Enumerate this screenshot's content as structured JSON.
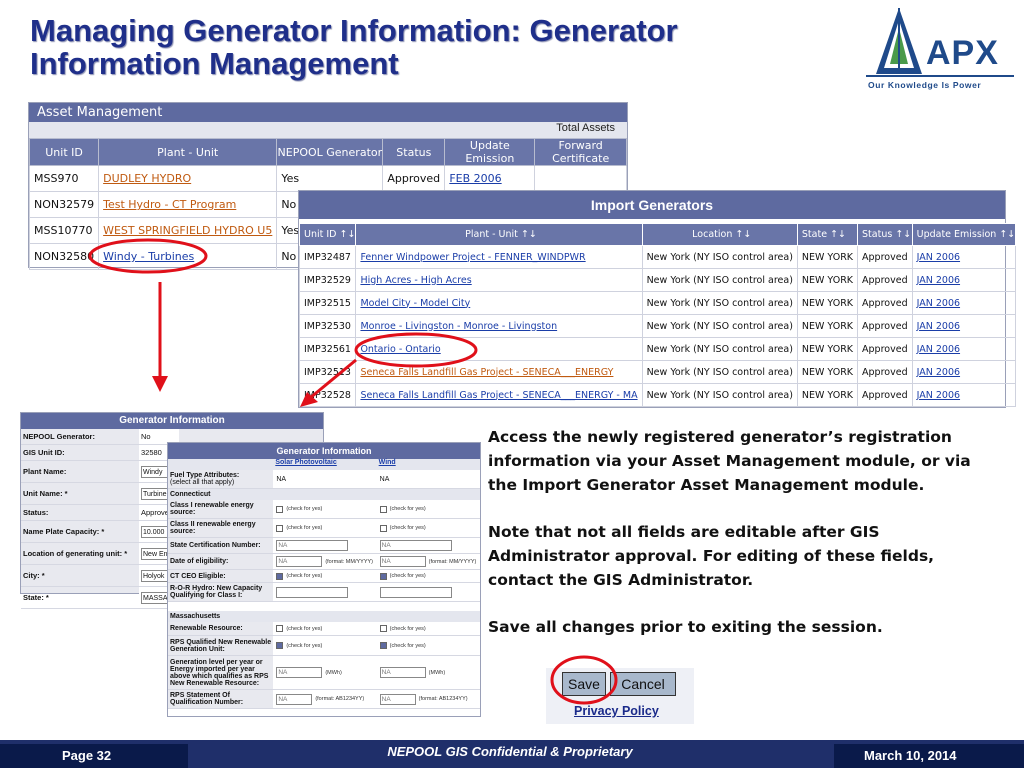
{
  "slide": {
    "title_line1": "Managing Generator Information: Generator",
    "title_line2": "Information Management",
    "logo_text": "APX",
    "logo_tagline": "Our Knowledge Is Power"
  },
  "asset_management": {
    "title": "Asset Management",
    "total_label": "Total Assets",
    "columns": [
      "Unit ID",
      "Plant - Unit",
      "NEPOOL Generator",
      "Status",
      "Update Emission",
      "Forward Certificate"
    ],
    "rows": [
      {
        "unit_id": "MSS970",
        "plant": "DUDLEY HYDRO",
        "nepool": "Yes",
        "status": "Approved",
        "update": "FEB 2006",
        "forward": ""
      },
      {
        "unit_id": "NON32579",
        "plant": "Test Hydro - CT Program",
        "nepool": "No",
        "status": "",
        "update": "",
        "forward": ""
      },
      {
        "unit_id": "MSS10770",
        "plant": "WEST SPRINGFIELD HYDRO U5",
        "nepool": "Yes",
        "status": "",
        "update": "",
        "forward": ""
      },
      {
        "unit_id": "NON32580",
        "plant": "Windy - Turbines",
        "nepool": "No",
        "status": "",
        "update": "",
        "forward": ""
      }
    ]
  },
  "import_generators": {
    "title": "Import Generators",
    "columns": [
      "Unit ID",
      "Plant - Unit",
      "Location",
      "State",
      "Status",
      "Update Emission"
    ],
    "rows": [
      {
        "unit_id": "IMP32487",
        "plant": "Fenner Windpower Project - FENNER_WINDPWR",
        "location": "New York (NY ISO control area)",
        "state": "NEW YORK",
        "status": "Approved",
        "update": "JAN 2006"
      },
      {
        "unit_id": "IMP32529",
        "plant": "High Acres - High Acres",
        "location": "New York (NY ISO control area)",
        "state": "NEW YORK",
        "status": "Approved",
        "update": "JAN 2006"
      },
      {
        "unit_id": "IMP32515",
        "plant": "Model City - Model City",
        "location": "New York (NY ISO control area)",
        "state": "NEW YORK",
        "status": "Approved",
        "update": "JAN 2006"
      },
      {
        "unit_id": "IMP32530",
        "plant": "Monroe - Livingston - Monroe - Livingston",
        "location": "New York (NY ISO control area)",
        "state": "NEW YORK",
        "status": "Approved",
        "update": "JAN 2006"
      },
      {
        "unit_id": "IMP32561",
        "plant": "Ontario - Ontario",
        "location": "New York (NY ISO control area)",
        "state": "NEW YORK",
        "status": "Approved",
        "update": "JAN 2006"
      },
      {
        "unit_id": "IMP32513",
        "plant": "Seneca Falls Landfill Gas Project - SENECA___ENERGY",
        "location": "New York (NY ISO control area)",
        "state": "NEW YORK",
        "status": "Approved",
        "update": "JAN 2006"
      },
      {
        "unit_id": "IMP32528",
        "plant": "Seneca Falls Landfill Gas Project - SENECA___ENERGY - MA",
        "location": "New York (NY ISO control area)",
        "state": "NEW YORK",
        "status": "Approved",
        "update": "JAN 2006"
      }
    ]
  },
  "gen_info_1": {
    "title": "Generator Information",
    "fields": [
      {
        "label": "NEPOOL Generator:",
        "value": "No"
      },
      {
        "label": "GIS Unit ID:",
        "value": "32580"
      },
      {
        "label": "Plant Name:",
        "value": "Windy"
      },
      {
        "label": "Unit Name: *",
        "value": "Turbine"
      },
      {
        "label": "Status:",
        "value": "Approve"
      },
      {
        "label": "Name Plate Capacity: *",
        "value": "10.000"
      },
      {
        "label": "Location of generating unit: *",
        "value": "New En"
      },
      {
        "label": "City: *",
        "value": "Holyok"
      },
      {
        "label": "State: *",
        "value": "MASSA"
      }
    ]
  },
  "gen_info_2": {
    "title": "Generator Information",
    "col1": "Solar Photovoltaic",
    "col2": "Wind",
    "fuel_label": "Fuel Type Attributes:",
    "fuel_sub": "(select all that apply)",
    "fuel_v1": "NA",
    "fuel_v2": "NA",
    "sec_ct": "Connecticut",
    "class1_label": "Class I renewable energy source:",
    "class2_label": "Class II renewable energy source:",
    "check_note": "(check for yes)",
    "cert_label": "State Certification Number:",
    "cert_v1": "NA",
    "cert_v2": "NA",
    "elig_label": "Date of eligibility:",
    "elig_v1": "NA",
    "elig_v2": "NA",
    "date_note": "(format: MM/YYYY)",
    "ceo_label": "CT CEO Eligible:",
    "ror_label": "R-O-R Hydro: New Capacity Qualifying for Class I:",
    "sec_ma": "Massachusetts",
    "rr_label": "Renewable Resource:",
    "rps_label": "RPS Qualified New Renewable Generation Unit:",
    "gen_label": "Generation level per year or Energy imported per year above which qualifies as RPS New Renewable Resource:",
    "gen_v1": "NA",
    "gen_v2": "NA",
    "mwh_note": "(MWh)",
    "stmt_label": "RPS Statement Of Qualification Number:",
    "stmt_v1": "NA",
    "stmt_v2": "NA",
    "stmt_note": "(format: AB1234YY)"
  },
  "description": {
    "p1": "Access the newly registered generator’s registration information via your Asset Management module, or via the Import Generator Asset Management module.",
    "p2": "Note that not all fields are editable after GIS Administrator approval.  For editing of these fields, contact the GIS Administrator.",
    "p3": "Save all changes prior to exiting the session."
  },
  "buttons": {
    "save": "Save",
    "cancel": "Cancel",
    "privacy": "Privacy Policy"
  },
  "footer": {
    "page": "Page 32",
    "center": "NEPOOL GIS Confidential & Proprietary",
    "date": "March 10, 2014"
  },
  "colors": {
    "title": "#1f2f8a",
    "panel_header": "#5e6aa0",
    "annotation": "#e0101a",
    "footer": "#1f2f6a"
  }
}
